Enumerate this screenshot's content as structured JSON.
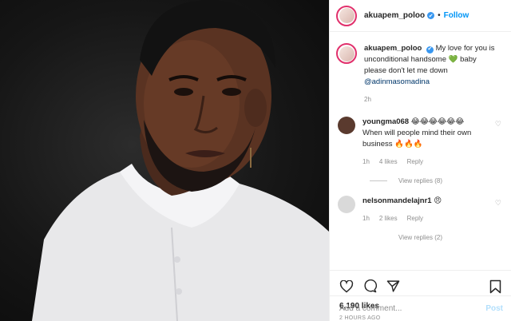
{
  "header": {
    "username": "akuapem_poloo",
    "verified_glyph": "✔",
    "separator": "•",
    "follow_label": "Follow"
  },
  "caption": {
    "username": "akuapem_poloo",
    "text_part1": "My love for you is unconditional handsome",
    "emoji_heart": "💚",
    "text_part2": "baby please don't let me down",
    "mention": "@adinmasomadina",
    "time": "2h"
  },
  "comments": [
    {
      "username": "youngma068",
      "emojis": "😂😂😂😂😂😂",
      "text": "When will people mind their own business",
      "fire": "🔥🔥🔥",
      "time": "1h",
      "likes": "4 likes",
      "reply": "Reply",
      "view_replies": "View replies (8)",
      "avatar_color": "#5a3a2e"
    },
    {
      "username": "nelsonmandelajnr1",
      "emojis": "😠",
      "time": "1h",
      "likes": "2 likes",
      "reply": "Reply",
      "view_replies": "View replies (2)",
      "avatar_color": "#d9d9d9"
    }
  ],
  "footer": {
    "likes": "6,190 likes",
    "time_ago": "2 HOURS AGO",
    "comment_placeholder": "Add a comment...",
    "post_label": "Post"
  },
  "icons": {
    "heart": "heart-icon",
    "comment": "comment-icon",
    "share": "share-icon",
    "bookmark": "bookmark-icon"
  },
  "colors": {
    "link_blue": "#0095f6",
    "mention": "#00376b",
    "verified": "#3897f0",
    "muted": "#8e8e8e"
  }
}
